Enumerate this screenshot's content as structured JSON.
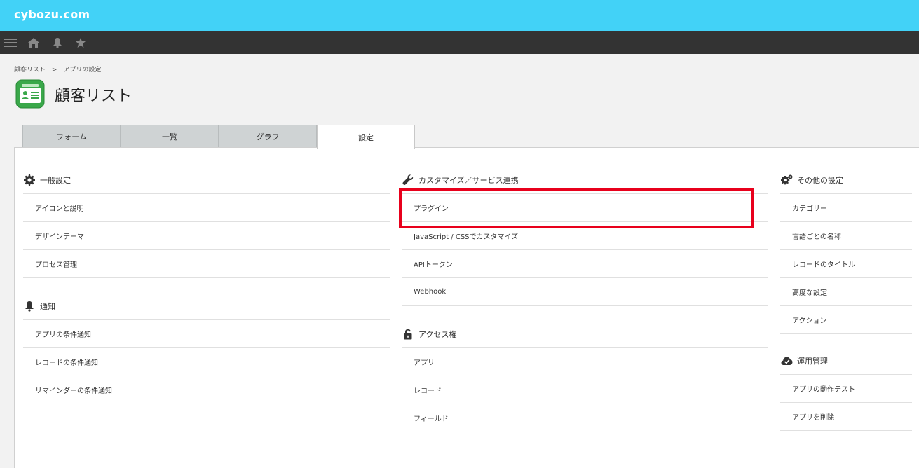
{
  "topbar": {
    "logo": "cybozu.com",
    "color": "#42d2f7"
  },
  "navbar": {
    "icons": [
      "menu-icon",
      "home-icon",
      "bell-icon",
      "star-icon"
    ]
  },
  "breadcrumb": {
    "items": [
      "顧客リスト",
      "アプリの設定"
    ],
    "separator": ">"
  },
  "app": {
    "title": "顧客リスト"
  },
  "tabs": [
    {
      "label": "フォーム",
      "active": false
    },
    {
      "label": "一覧",
      "active": false
    },
    {
      "label": "グラフ",
      "active": false
    },
    {
      "label": "設定",
      "active": true
    }
  ],
  "sections": {
    "general": {
      "title": "一般設定",
      "icon": "gear-icon",
      "items": [
        "アイコンと説明",
        "デザインテーマ",
        "プロセス管理"
      ]
    },
    "notification": {
      "title": "通知",
      "icon": "bell-icon",
      "items": [
        "アプリの条件通知",
        "レコードの条件通知",
        "リマインダーの条件通知"
      ]
    },
    "customize": {
      "title": "カスタマイズ／サービス連携",
      "icon": "wrench-icon",
      "items": [
        "プラグイン",
        "JavaScript / CSSでカスタマイズ",
        "APIトークン",
        "Webhook"
      ]
    },
    "access": {
      "title": "アクセス権",
      "icon": "lock-icon",
      "items": [
        "アプリ",
        "レコード",
        "フィールド"
      ]
    },
    "other": {
      "title": "その他の設定",
      "icon": "gears-icon",
      "items": [
        "カテゴリー",
        "言語ごとの名称",
        "レコードのタイトル",
        "高度な設定",
        "アクション"
      ]
    },
    "operation": {
      "title": "運用管理",
      "icon": "cloud-check-icon",
      "items": [
        "アプリの動作テスト",
        "アプリを削除"
      ]
    }
  },
  "highlight_color": "#e8001c"
}
